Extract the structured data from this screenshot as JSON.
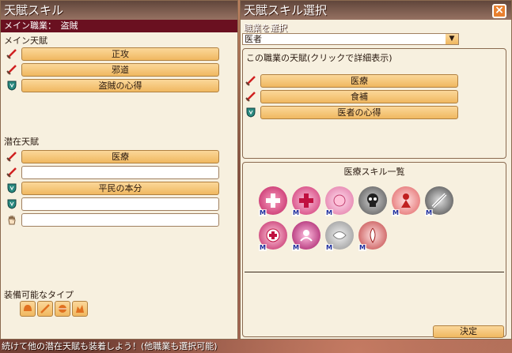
{
  "left": {
    "title": "天賦スキル",
    "job_line": "メイン職業：　盗賊",
    "main_section": "メイン天賦",
    "main_slots": [
      {
        "icon": "sword-icon",
        "label": "正攻"
      },
      {
        "icon": "sword-icon",
        "label": "邪道"
      },
      {
        "icon": "shield-icon",
        "label": "盗賊の心得"
      }
    ],
    "latent_section": "潜在天賦",
    "latent_slots": [
      {
        "icon": "sword-icon",
        "label": "医療"
      },
      {
        "icon": "sword-icon",
        "label": ""
      },
      {
        "icon": "shield-icon",
        "label": "平民の本分"
      },
      {
        "icon": "shield-icon",
        "label": ""
      },
      {
        "icon": "hand-icon",
        "label": ""
      }
    ],
    "equip_section": "装備可能なタイプ",
    "equip_icons": [
      "helmet-icon",
      "sword-icon",
      "armor-icon",
      "boots-icon"
    ]
  },
  "right": {
    "title": "天賦スキル選択",
    "select_label": "職業を選択",
    "select_value": "医者",
    "talent_heading": "この職業の天賦(クリックで詳細表示)",
    "talent_slots": [
      {
        "icon": "sword-icon",
        "label": "医療"
      },
      {
        "icon": "sword-icon",
        "label": "食補"
      },
      {
        "icon": "shield-icon",
        "label": "医者の心得"
      }
    ],
    "skill_list_heading": "医療スキル一覧",
    "skills_row1": [
      "M",
      "M",
      "M",
      "",
      "M",
      "M"
    ],
    "skills_row2": [
      "M",
      "M",
      "M",
      "M"
    ],
    "decide_label": "決定"
  },
  "bottom_text": "続けて他の潜在天賦も装着しよう！(他職業も選択可能)",
  "colors": {
    "slot_fill": "#f0b860",
    "job_bar": "#6a1020",
    "panel": "#f7f0df",
    "close": "#e88030"
  }
}
